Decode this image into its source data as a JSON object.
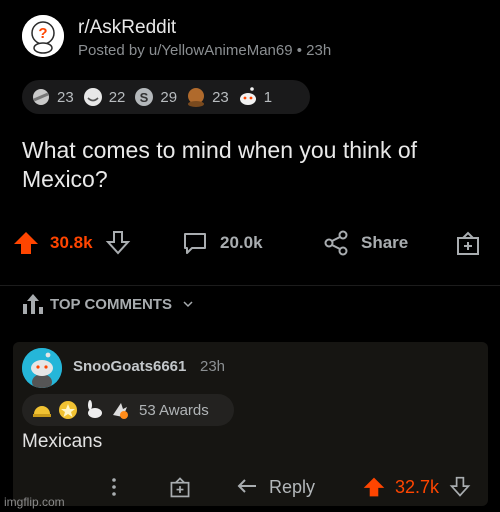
{
  "post": {
    "subreddit": "r/AskReddit",
    "posted_by": "Posted by u/YellowAnimeMan69 • 23h",
    "title": "What comes to mind when you think of Mexico?",
    "awards": [
      {
        "icon": "hugz-award-icon",
        "count": "23"
      },
      {
        "icon": "wholesome-award-icon",
        "count": "22"
      },
      {
        "icon": "silver-award-icon",
        "count": "29"
      },
      {
        "icon": "facepalm-award-icon",
        "count": "23"
      },
      {
        "icon": "snoo-award-icon",
        "count": "1"
      }
    ],
    "upvotes": "30.8k",
    "comments": "20.0k",
    "share_label": "Share"
  },
  "section": {
    "label": "TOP COMMENTS"
  },
  "comment": {
    "username": "SnooGoats6661",
    "time": "23h",
    "awards_label": "53 Awards",
    "body": "Mexicans",
    "reply_label": "Reply",
    "upvotes": "32.7k"
  },
  "watermark": "imgflip.com",
  "colors": {
    "upvote": "#ff4500",
    "background": "#000000",
    "card": "#161512"
  }
}
